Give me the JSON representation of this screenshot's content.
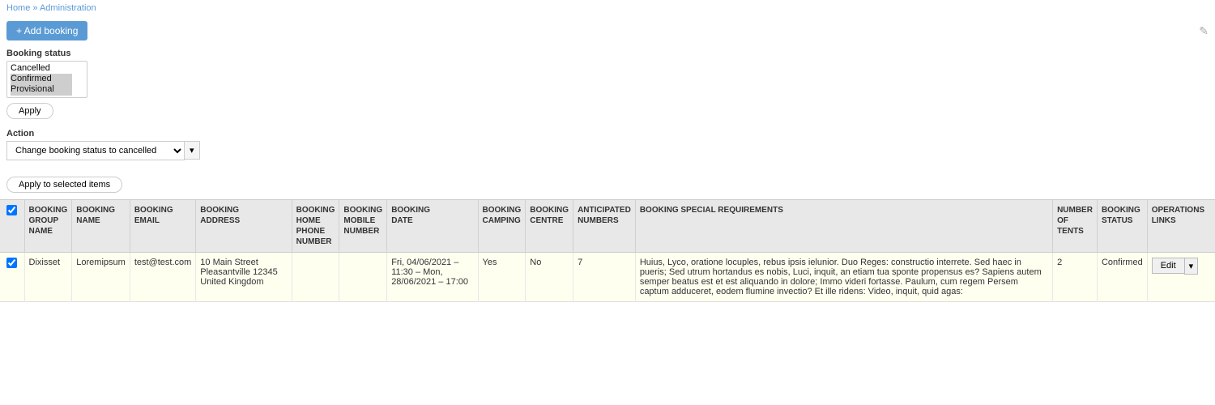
{
  "breadcrumb": {
    "home": "Home",
    "admin": "Administration"
  },
  "toolbar": {
    "add_booking_label": "+ Add booking",
    "edit_icon": "✎"
  },
  "booking_status_filter": {
    "label": "Booking status",
    "options": [
      "Cancelled",
      "Confirmed",
      "Provisional"
    ],
    "selected": [
      "Cancelled",
      "Confirmed",
      "Provisional"
    ]
  },
  "apply_button": {
    "label": "Apply"
  },
  "action_section": {
    "label": "Action",
    "action_value": "Change booking status to cancelled",
    "dropdown_icon": "▾",
    "apply_selected_label": "Apply to selected items"
  },
  "table": {
    "columns": [
      "",
      "Booking Group Name",
      "Booking Name",
      "Booking Email",
      "Booking Address",
      "Booking Home Phone Number",
      "Booking Mobile Number",
      "Booking Date",
      "Booking Camping",
      "Booking Centre",
      "Anticipated Numbers",
      "Booking Special Requirements",
      "Number of Tents",
      "Booking Status",
      "Operations Links"
    ],
    "rows": [
      {
        "checked": true,
        "group_name": "Dixisset",
        "booking_name": "Loremipsum",
        "email": "test@test.com",
        "address": "10 Main Street Pleasantville 12345 United Kingdom",
        "home_phone": "",
        "mobile": "",
        "date": "Fri, 04/06/2021 – 11:30 – Mon, 28/06/2021 – 17:00",
        "camping": "Yes",
        "centre": "No",
        "anticipated": "7",
        "special_req": "Huius, Lyco, oratione locuples, rebus ipsis ielunior. Duo Reges: constructio interrete. Sed haec in pueris; Sed utrum hortandus es nobis, Luci, inquit, an etiam tua sponte propensus es? Sapiens autem semper beatus est et est aliquando in dolore; Immo videri fortasse. Paulum, cum regem Persem captum adduceret, eodem flumine invectio? Et ille ridens: Video, inquit, quid agas:",
        "num_tents": "2",
        "status": "Confirmed",
        "edit_label": "Edit",
        "dropdown_icon": "▾"
      }
    ]
  }
}
